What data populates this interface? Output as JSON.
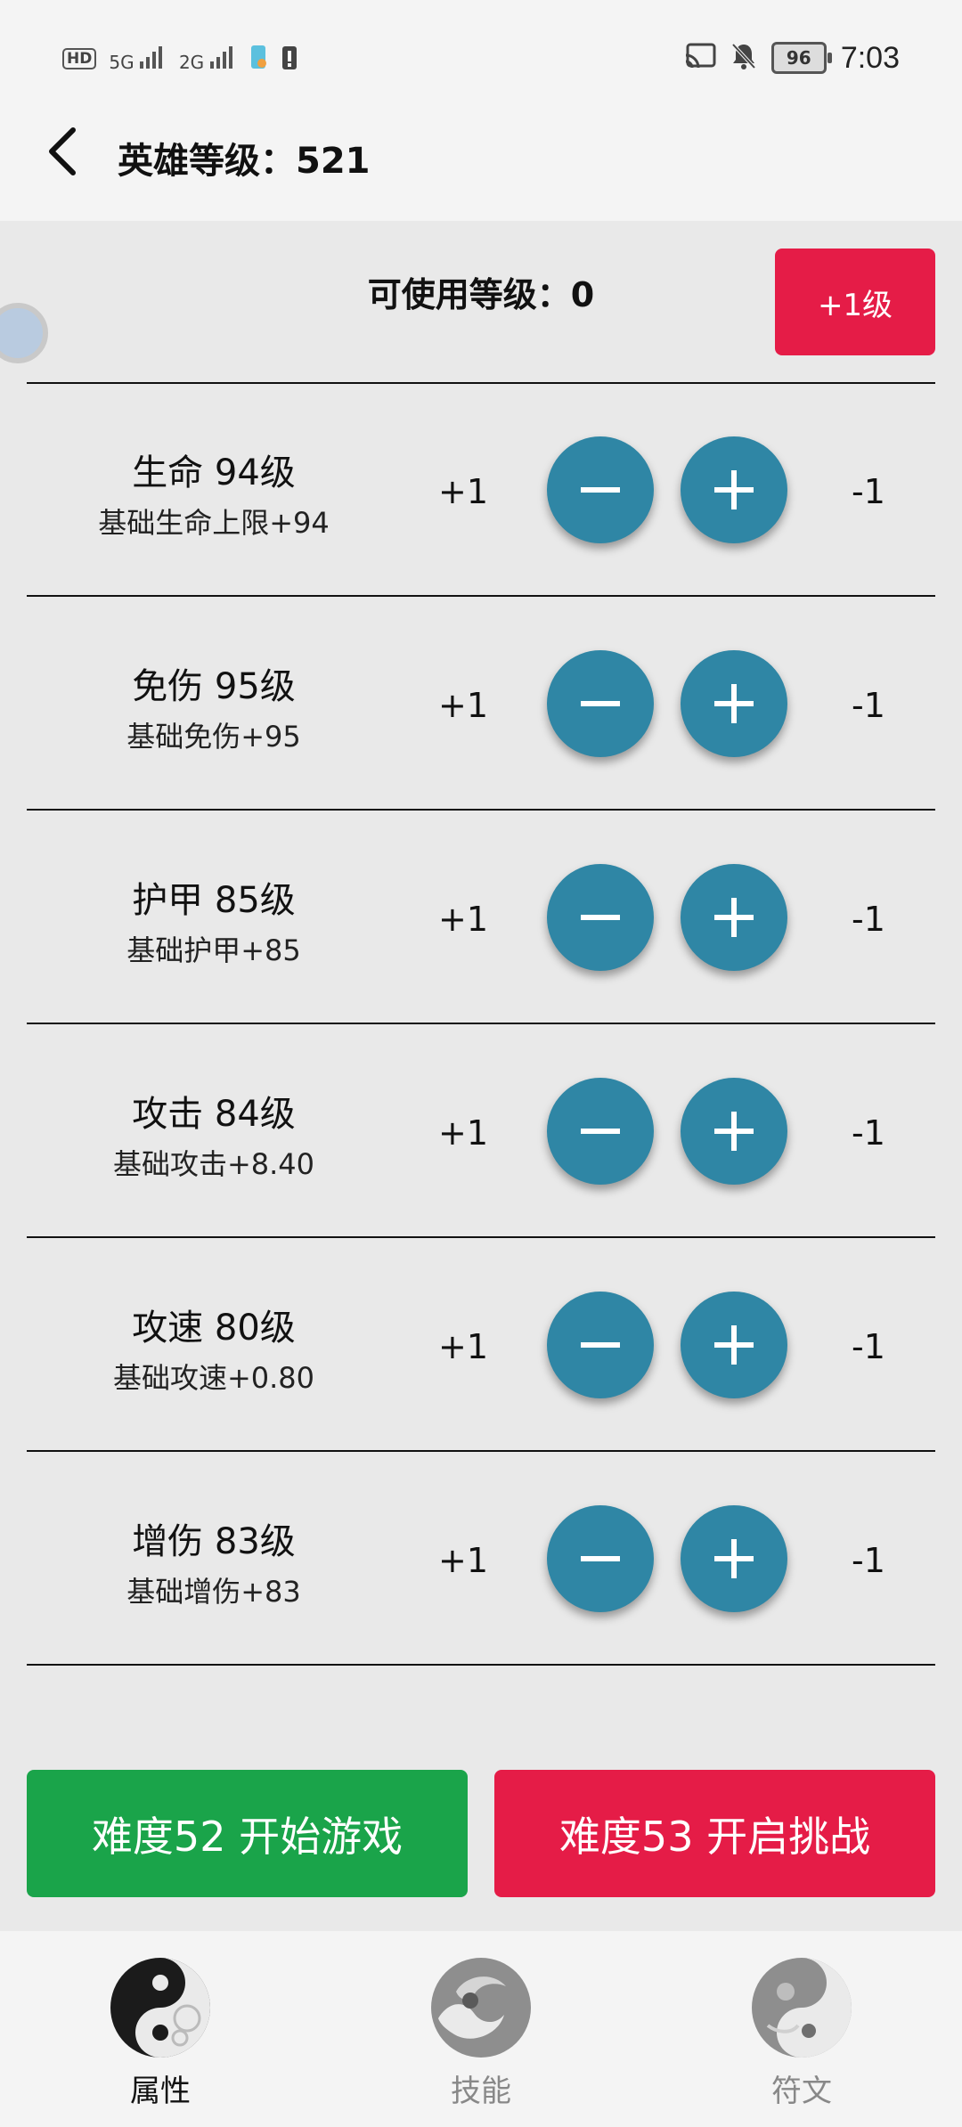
{
  "status_bar": {
    "hd": "HD",
    "sim1": "5G",
    "sim2": "2G",
    "battery": "96",
    "time": "7:03"
  },
  "header": {
    "title": "英雄等级：521"
  },
  "available": {
    "label": "可使用等级：0",
    "button": "+1级"
  },
  "attributes": [
    {
      "name": "生命 94级",
      "desc": "基础生命上限+94",
      "inc": "+1",
      "dec": "-1"
    },
    {
      "name": "免伤 95级",
      "desc": "基础免伤+95",
      "inc": "+1",
      "dec": "-1"
    },
    {
      "name": "护甲 85级",
      "desc": "基础护甲+85",
      "inc": "+1",
      "dec": "-1"
    },
    {
      "name": "攻击 84级",
      "desc": "基础攻击+8.40",
      "inc": "+1",
      "dec": "-1"
    },
    {
      "name": "攻速 80级",
      "desc": "基础攻速+0.80",
      "inc": "+1",
      "dec": "-1"
    },
    {
      "name": "增伤 83级",
      "desc": "基础增伤+83",
      "inc": "+1",
      "dec": "-1"
    }
  ],
  "actions": {
    "start": "难度52 开始游戏",
    "challenge": "难度53 开启挑战"
  },
  "nav": [
    {
      "label": "属性",
      "icon": "yin-yang-icon",
      "active": true
    },
    {
      "label": "技能",
      "icon": "wave-icon",
      "active": false
    },
    {
      "label": "符文",
      "icon": "swirl-icon",
      "active": false
    }
  ],
  "colors": {
    "accent_red": "#e51c47",
    "accent_green": "#1aa44a",
    "circle_button": "#2f86a5"
  }
}
